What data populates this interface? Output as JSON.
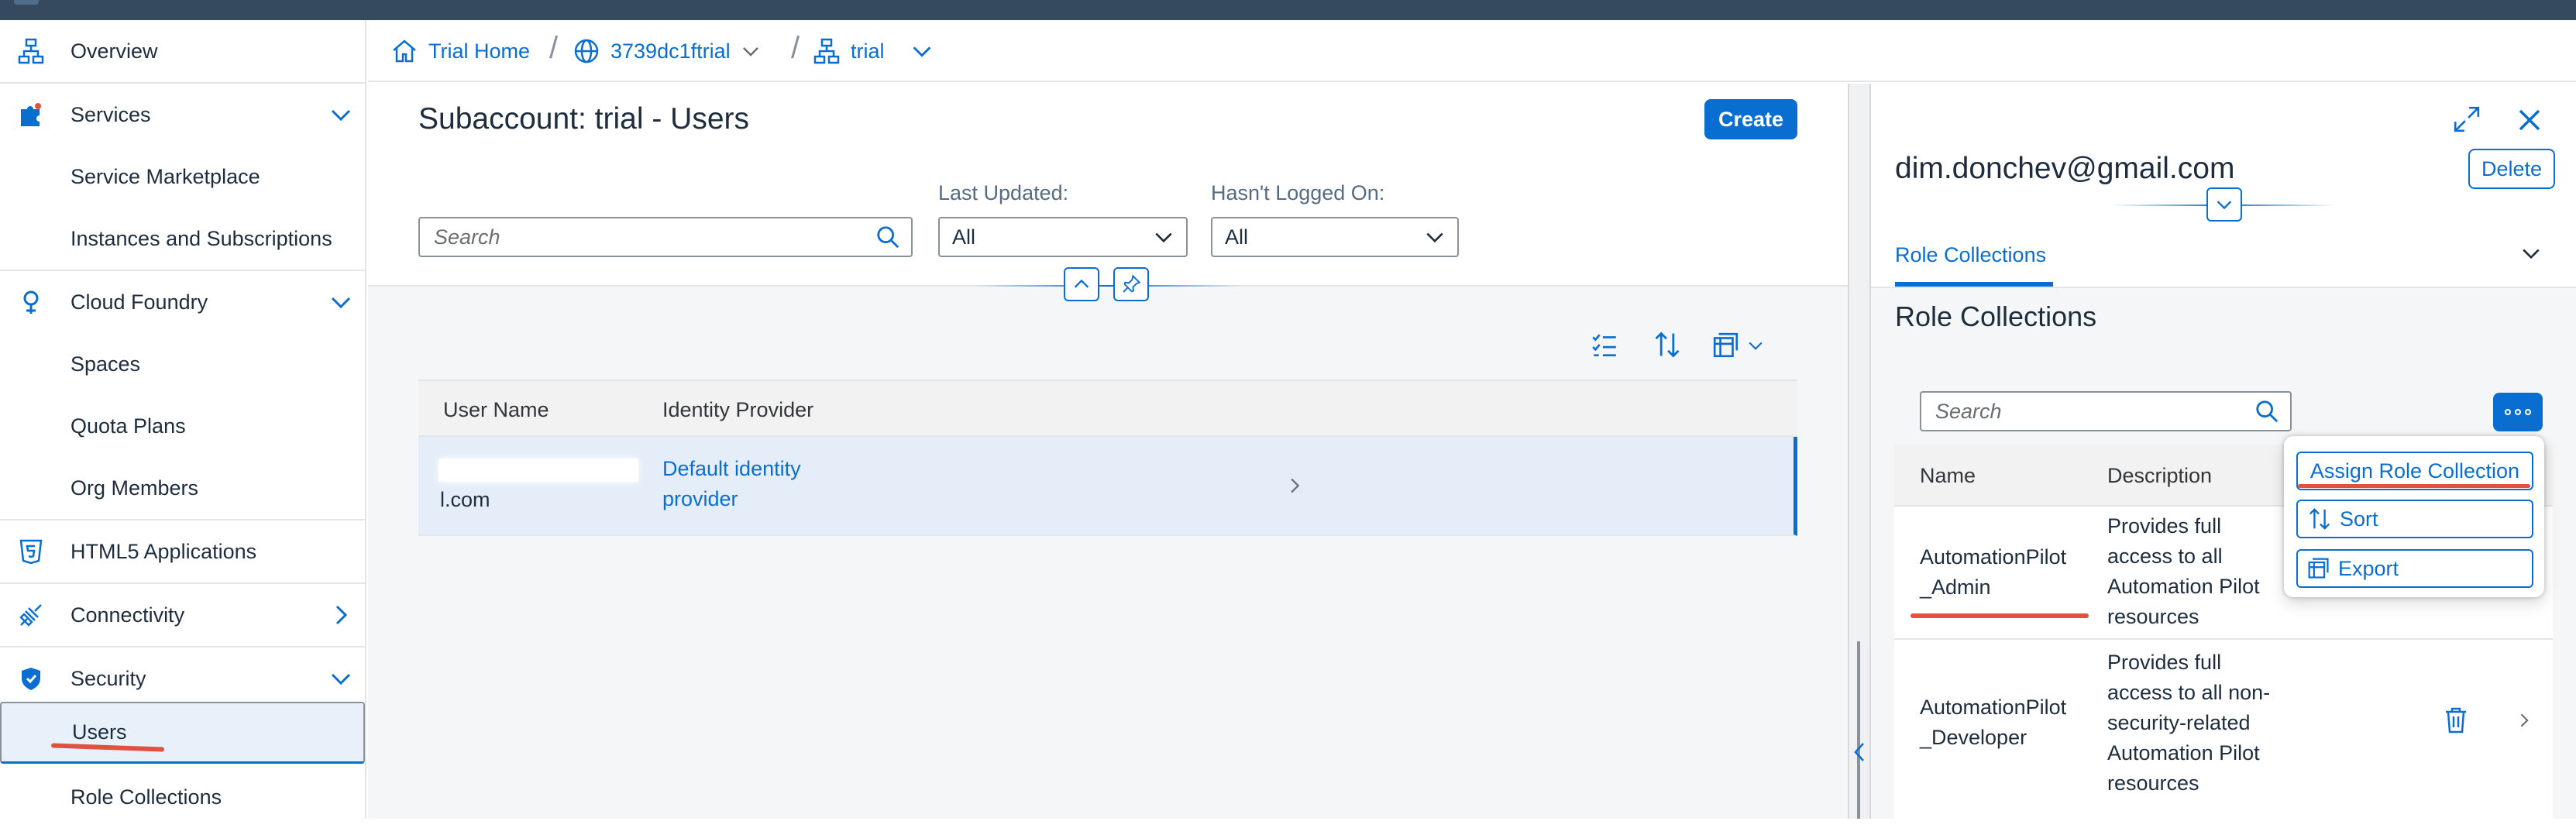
{
  "sidebar": {
    "items": [
      {
        "label": "Overview",
        "icon": "hierarchy-icon"
      },
      {
        "label": "Services",
        "icon": "puzzle-icon"
      },
      {
        "label": "Service Marketplace"
      },
      {
        "label": "Instances and Subscriptions"
      },
      {
        "label": "Cloud Foundry",
        "icon": "cloud-foundry-icon"
      },
      {
        "label": "Spaces"
      },
      {
        "label": "Quota Plans"
      },
      {
        "label": "Org Members"
      },
      {
        "label": "HTML5 Applications",
        "icon": "html5-icon"
      },
      {
        "label": "Connectivity",
        "icon": "connection-icon"
      },
      {
        "label": "Security",
        "icon": "shield-icon"
      },
      {
        "label": "Users"
      },
      {
        "label": "Role Collections"
      }
    ]
  },
  "breadcrumb": {
    "home": "Trial Home",
    "globalaccount": "3739dc1ftrial",
    "subaccount": "trial"
  },
  "main": {
    "title": "Subaccount: trial - Users",
    "create_label": "Create",
    "search_placeholder": "Search",
    "filters": {
      "last_updated_label": "Last Updated:",
      "last_updated_value": "All",
      "hasnt_logged_on_label": "Hasn't Logged On:",
      "hasnt_logged_on_value": "All"
    },
    "table": {
      "columns": [
        "User Name",
        "Identity Provider"
      ],
      "rows": [
        {
          "user_name_visible": "l.com",
          "identity_provider_line1": "Default identity",
          "identity_provider_line2": "provider"
        }
      ]
    }
  },
  "detail": {
    "user_email": "dim.donchev@gmail.com",
    "delete_label": "Delete",
    "tab": "Role Collections",
    "section_title": "Role Collections",
    "search_placeholder": "Search",
    "table": {
      "columns": [
        "Name",
        "Description"
      ],
      "rows": [
        {
          "name_line1": "AutomationPilot",
          "name_line2": "_Admin",
          "desc": [
            "Provides full",
            "access to all",
            "Automation Pilot",
            "resources"
          ]
        },
        {
          "name_line1": "AutomationPilot",
          "name_line2": "_Developer",
          "desc": [
            "Provides full",
            "access to all non-",
            "security-related",
            "Automation Pilot",
            "resources"
          ]
        }
      ]
    },
    "menu": {
      "items": [
        "Assign Role Collection",
        "Sort",
        "Export"
      ]
    }
  },
  "colors": {
    "accent": "#0a6ed1",
    "shell": "#354a5f",
    "annotation": "#e0523f"
  }
}
